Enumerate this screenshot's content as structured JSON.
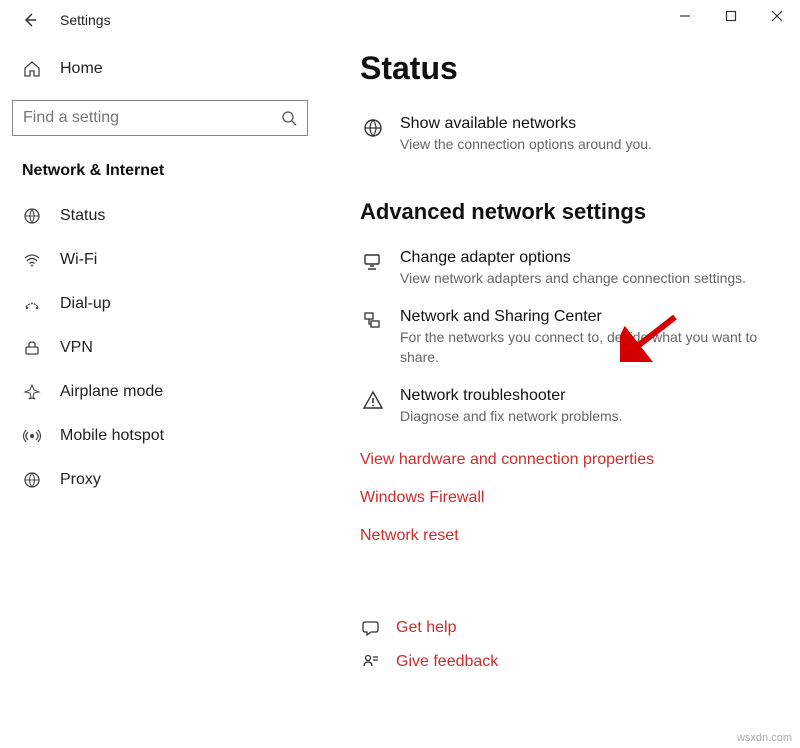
{
  "titlebar": {
    "title": "Settings"
  },
  "sidebar": {
    "home_label": "Home",
    "search_placeholder": "Find a setting",
    "section_title": "Network & Internet",
    "items": [
      {
        "label": "Status"
      },
      {
        "label": "Wi-Fi"
      },
      {
        "label": "Dial-up"
      },
      {
        "label": "VPN"
      },
      {
        "label": "Airplane mode"
      },
      {
        "label": "Mobile hotspot"
      },
      {
        "label": "Proxy"
      }
    ]
  },
  "main": {
    "page_title": "Status",
    "show_networks": {
      "title": "Show available networks",
      "sub": "View the connection options around you."
    },
    "advanced_title": "Advanced network settings",
    "adapter": {
      "title": "Change adapter options",
      "sub": "View network adapters and change connection settings."
    },
    "sharing": {
      "title": "Network and Sharing Center",
      "sub": "For the networks you connect to, decide what you want to share."
    },
    "troubleshoot": {
      "title": "Network troubleshooter",
      "sub": "Diagnose and fix network problems."
    },
    "link_hw": "View hardware and connection properties",
    "link_fw": "Windows Firewall",
    "link_reset": "Network reset",
    "help_get": "Get help",
    "help_feedback": "Give feedback"
  },
  "watermark": "wsxdn.com"
}
